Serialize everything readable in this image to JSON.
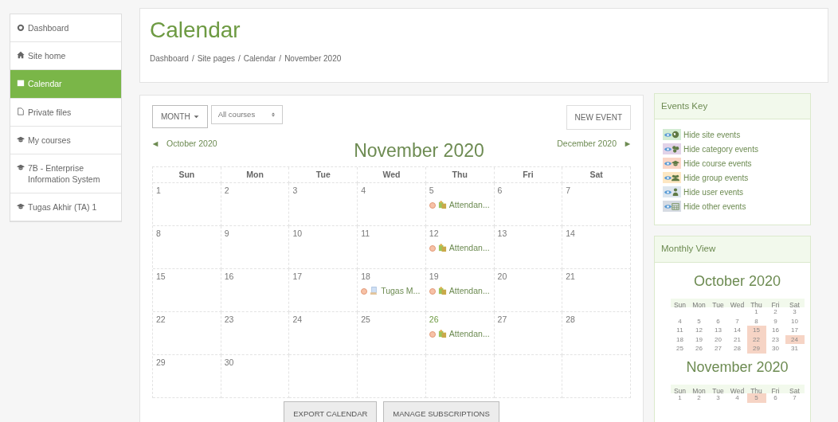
{
  "sidebar": {
    "items": [
      {
        "label": "Dashboard",
        "kind": "dashboard",
        "selected": false
      },
      {
        "label": "Site home",
        "kind": "home",
        "selected": false
      },
      {
        "label": "Calendar",
        "kind": "calendar",
        "selected": true
      },
      {
        "label": "Private files",
        "kind": "file",
        "selected": false
      },
      {
        "label": "My courses",
        "kind": "course",
        "selected": false
      },
      {
        "label": "7B - Enterprise Information System",
        "kind": "course",
        "selected": false
      },
      {
        "label": "Tugas Akhir (TA) 1",
        "kind": "course",
        "selected": false
      }
    ]
  },
  "header": {
    "title": "Calendar",
    "breadcrumb": [
      "Dashboard",
      "Site pages",
      "Calendar",
      "November 2020"
    ],
    "breadcrumb_separator": "/"
  },
  "calendar": {
    "view_menu": "MONTH",
    "course_select": "All courses",
    "new_event": "NEW EVENT",
    "prev": "October 2020",
    "title": "November 2020",
    "next": "December 2020",
    "weekdays": [
      "Sun",
      "Mon",
      "Tue",
      "Wed",
      "Thu",
      "Fri",
      "Sat"
    ],
    "weeks": [
      [
        {
          "day": "1"
        },
        {
          "day": "2"
        },
        {
          "day": "3"
        },
        {
          "day": "4"
        },
        {
          "day": "5",
          "events": [
            {
              "name": "Attendan...",
              "kind": "attendance"
            }
          ]
        },
        {
          "day": "6"
        },
        {
          "day": "7"
        }
      ],
      [
        {
          "day": "8"
        },
        {
          "day": "9"
        },
        {
          "day": "10"
        },
        {
          "day": "11"
        },
        {
          "day": "12",
          "events": [
            {
              "name": "Attendan...",
              "kind": "attendance"
            }
          ]
        },
        {
          "day": "13"
        },
        {
          "day": "14"
        }
      ],
      [
        {
          "day": "15"
        },
        {
          "day": "16"
        },
        {
          "day": "17"
        },
        {
          "day": "18",
          "events": [
            {
              "name": "Tugas M...",
              "kind": "assignment"
            }
          ]
        },
        {
          "day": "19",
          "events": [
            {
              "name": "Attendan...",
              "kind": "attendance"
            }
          ]
        },
        {
          "day": "20"
        },
        {
          "day": "21"
        }
      ],
      [
        {
          "day": "22"
        },
        {
          "day": "23"
        },
        {
          "day": "24"
        },
        {
          "day": "25"
        },
        {
          "day": "26",
          "today": true,
          "events": [
            {
              "name": "Attendan...",
              "kind": "attendance"
            }
          ]
        },
        {
          "day": "27"
        },
        {
          "day": "28"
        }
      ],
      [
        {
          "day": "29"
        },
        {
          "day": "30"
        }
      ]
    ],
    "buttons": [
      "EXPORT CALENDAR",
      "MANAGE SUBSCRIPTIONS"
    ]
  },
  "events_key": {
    "title": "Events Key",
    "items": [
      {
        "label": "Hide site events",
        "kind": "site",
        "color": "#d3ecd3"
      },
      {
        "label": "Hide category events",
        "kind": "category",
        "color": "#e2d3e8"
      },
      {
        "label": "Hide course events",
        "kind": "course",
        "color": "#fbd6c7"
      },
      {
        "label": "Hide group events",
        "kind": "group",
        "color": "#fde7c2"
      },
      {
        "label": "Hide user events",
        "kind": "user",
        "color": "#dde6ee"
      },
      {
        "label": "Hide other events",
        "kind": "other",
        "color": "#d6dbe3"
      }
    ]
  },
  "monthly_view": {
    "title": "Monthly View",
    "months": [
      {
        "title": "October 2020",
        "weekdays": [
          "Sun",
          "Mon",
          "Tue",
          "Wed",
          "Thu",
          "Fri",
          "Sat"
        ],
        "weeks": [
          [
            {
              "day": "1",
              "event": false
            },
            {
              "day": "2",
              "event": false
            },
            {
              "day": "3",
              "event": false
            }
          ],
          [
            {
              "day": "4",
              "event": false
            },
            {
              "day": "5",
              "event": false
            },
            {
              "day": "6",
              "event": false
            },
            {
              "day": "7",
              "event": false
            },
            {
              "day": "8",
              "event": false
            },
            {
              "day": "9",
              "event": false
            },
            {
              "day": "10",
              "event": false
            }
          ],
          [
            {
              "day": "11",
              "event": false
            },
            {
              "day": "12",
              "event": false
            },
            {
              "day": "13",
              "event": false
            },
            {
              "day": "14",
              "event": false
            },
            {
              "day": "15",
              "event": true
            },
            {
              "day": "16",
              "event": false
            },
            {
              "day": "17",
              "event": false
            }
          ],
          [
            {
              "day": "18",
              "event": false
            },
            {
              "day": "19",
              "event": false
            },
            {
              "day": "20",
              "event": false
            },
            {
              "day": "21",
              "event": false
            },
            {
              "day": "22",
              "event": true
            },
            {
              "day": "23",
              "event": false
            },
            {
              "day": "24",
              "event": true
            }
          ],
          [
            {
              "day": "25",
              "event": false
            },
            {
              "day": "26",
              "event": false
            },
            {
              "day": "27",
              "event": false
            },
            {
              "day": "28",
              "event": false
            },
            {
              "day": "29",
              "event": true
            },
            {
              "day": "30",
              "event": false
            },
            {
              "day": "31",
              "event": false
            }
          ]
        ]
      },
      {
        "title": "November 2020",
        "weekdays": [
          "Sun",
          "Mon",
          "Tue",
          "Wed",
          "Thu",
          "Fri",
          "Sat"
        ],
        "weeks": [
          [
            {
              "day": "1",
              "event": false
            },
            {
              "day": "2",
              "event": false
            },
            {
              "day": "3",
              "event": false
            },
            {
              "day": "4",
              "event": false
            },
            {
              "day": "5",
              "event": true
            },
            {
              "day": "6",
              "event": false
            },
            {
              "day": "7",
              "event": false
            }
          ]
        ]
      }
    ]
  }
}
